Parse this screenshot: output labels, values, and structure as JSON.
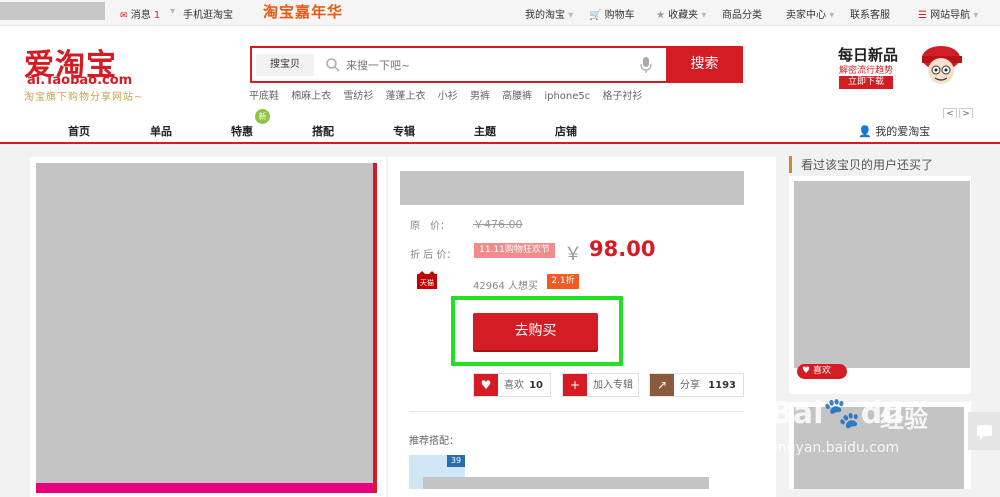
{
  "topbar": {
    "message": "消息",
    "message_count": "1",
    "mobile": "手机逛淘宝",
    "festival": "淘宝嘉年华",
    "links": [
      "我的淘宝",
      "购物车",
      "收藏夹",
      "商品分类",
      "卖家中心",
      "联系客服",
      "网站导航"
    ]
  },
  "logo": {
    "cn": "爱淘宝",
    "en": "ai.Taobao.com",
    "slogan": "淘宝旗下购物分享网站~"
  },
  "search": {
    "type": "搜宝贝",
    "placeholder": "来搜一下吧~",
    "button": "搜索",
    "hot": [
      "平底鞋",
      "棉麻上衣",
      "雪纺衫",
      "蓬蓬上衣",
      "小衫",
      "男裤",
      "高腰裤",
      "iphone5c",
      "格子衬衫"
    ]
  },
  "promo": {
    "title": "每日新品",
    "sub": "解密流行趋势",
    "button": "立即下载"
  },
  "nav": {
    "items": [
      "首页",
      "单品",
      "特惠",
      "搭配",
      "专辑",
      "主题",
      "店铺"
    ],
    "new_badge": "新",
    "user": "我的爱淘宝"
  },
  "product": {
    "original_label": "原　价：",
    "original_price": "￥476.00",
    "discount_label": "折 后 价：",
    "promo_tag": "11.11购物狂欢节",
    "currency": "￥",
    "price": "98.00",
    "store_badge": "天猫",
    "wants": "42964 人想买",
    "discount": "2.1折",
    "buy_button": "去购买",
    "like_label": "喜欢",
    "like_count": "10",
    "album_label": "加入专辑",
    "share_label": "分享",
    "share_count": "1193",
    "rec_label": "推荐搭配：",
    "rec_badge": "39"
  },
  "right": {
    "title": "看过该宝贝的用户还买了",
    "like": "喜欢"
  },
  "watermark": {
    "text": "Bai",
    "text2": "du",
    "cn": "经验",
    "url": "jingyan.baidu.com"
  },
  "colors": {
    "brand": "#d41c24",
    "highlight": "#22e022"
  }
}
